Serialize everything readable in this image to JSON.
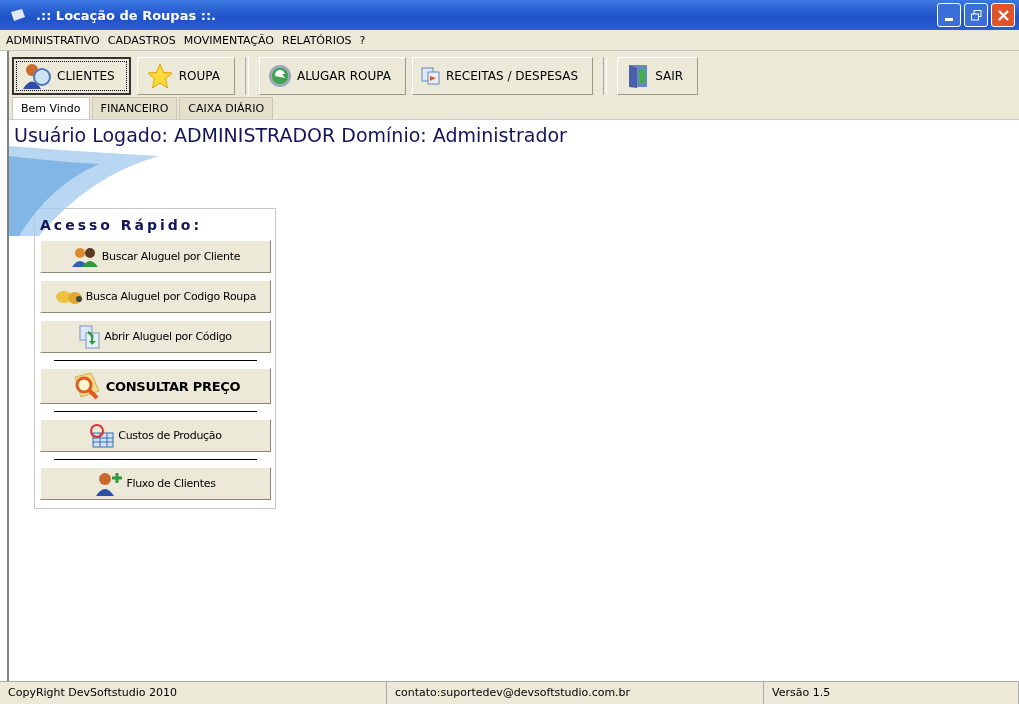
{
  "window": {
    "title": ".:: Locação de Roupas ::."
  },
  "menu": [
    "ADMINISTRATIVO",
    "CADASTROS",
    "MOVIMENTAÇÃO",
    "RELATÓRIOS",
    "?"
  ],
  "toolbar": [
    {
      "kind": "button",
      "label": "CLIENTES",
      "selected": true
    },
    {
      "kind": "button",
      "label": "ROUPA",
      "selected": false
    },
    {
      "kind": "separator"
    },
    {
      "kind": "button",
      "label": "ALUGAR ROUPA",
      "selected": false
    },
    {
      "kind": "button",
      "label": "RECEITAS / DESPESAS",
      "selected": false
    },
    {
      "kind": "separator"
    },
    {
      "kind": "button",
      "label": "SAIR",
      "selected": false
    }
  ],
  "tabs": [
    {
      "label": "Bem Vindo",
      "selected": true
    },
    {
      "label": "FINANCEIRO",
      "selected": false
    },
    {
      "label": "CAIXA DIÁRIO",
      "selected": false
    }
  ],
  "heading": "Usuário Logado: ADMINISTRADOR Domínio: Administrador",
  "quick_access": {
    "title": "Acesso Rápido:",
    "items": [
      {
        "kind": "button",
        "label": "Buscar Aluguel por Cliente",
        "bold": false
      },
      {
        "kind": "button",
        "label": "Busca Aluguel por Codigo Roupa",
        "bold": false
      },
      {
        "kind": "button",
        "label": "Abrir Aluguel por Código",
        "bold": false
      },
      {
        "kind": "separator"
      },
      {
        "kind": "button",
        "label": "CONSULTAR PREÇO",
        "bold": true
      },
      {
        "kind": "separator"
      },
      {
        "kind": "button",
        "label": "Custos de Produção",
        "bold": false
      },
      {
        "kind": "separator"
      },
      {
        "kind": "button",
        "label": "Fluxo de Clientes",
        "bold": false
      }
    ]
  },
  "status_bar": [
    "CopyRight DevSoftstudio 2010",
    "contato:suportedev@devsoftstudio.com.br",
    "Versão 1.5"
  ]
}
